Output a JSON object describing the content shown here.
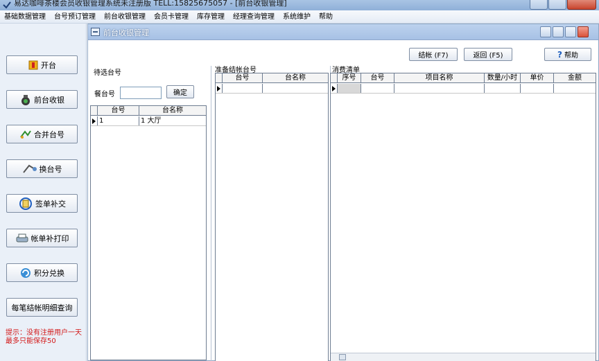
{
  "window": {
    "title": "易达咖啡茶楼会员收银管理系统未注册版 TELL:15825675057 - [前台收银管理]"
  },
  "menu": [
    "基础数据管理",
    "台号预订管理",
    "前台收银管理",
    "会员卡管理",
    "库存管理",
    "经理查询管理",
    "系统维护",
    "帮助"
  ],
  "sidebar": {
    "buttons": [
      "开台",
      "前台收银",
      "合并台号",
      "换台号",
      "签单补交",
      "帐单补打印",
      "积分兑换",
      "每笔结帐明细查询"
    ],
    "hint": "提示：没有注册用户一天最多只能保存50"
  },
  "child": {
    "title": "前台收银管理",
    "checkout_label": "结帐 (F7)",
    "return_label": "返回 (F5)",
    "help_label": "帮助"
  },
  "left_panel": {
    "label": "待选台号",
    "search_label": "餐台号",
    "search_value": "",
    "confirm_label": "确定",
    "headers": [
      "台号",
      "台名称"
    ],
    "rows": [
      [
        "1",
        "1 大厅"
      ]
    ]
  },
  "mid_panel": {
    "label": "准备结帐台号",
    "headers": [
      "台号",
      "台名称"
    ]
  },
  "right_panel": {
    "label": "消费清单",
    "headers": [
      "序号",
      "台号",
      "项目名称",
      "数量/小时",
      "单价",
      "金额"
    ]
  }
}
